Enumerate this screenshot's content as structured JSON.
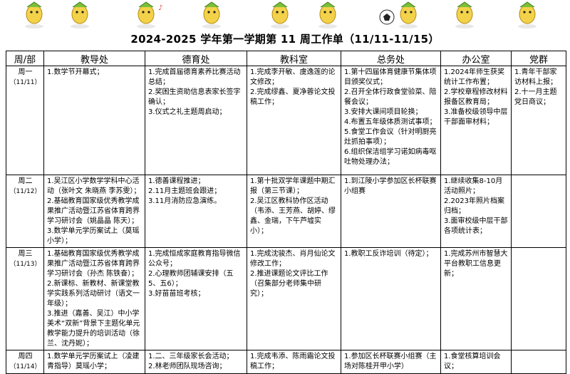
{
  "title": "2024-2025 学年第一学期第 11 周工作单（11/11-11/15）",
  "headers": [
    "周/部",
    "教导处",
    "德育处",
    "教科室",
    "总务处",
    "办公室",
    "党群"
  ],
  "rows": [
    {
      "day": "周一",
      "date": "（11/11）",
      "cells": [
        [
          "1.数学节开幕式；"
        ],
        [
          "1.完成首届德育素养比赛活动总结；",
          "2.奖困生资助信息表家长签字确认；",
          "3.仪式之礼主题周启动；"
        ],
        [
          "1.完成李开敏、虞逸莲的论文修改；",
          "2.完成缪鑫、夏净蓉论文投稿工作；"
        ],
        [
          "1.第十四届体育健康节集体项目颁奖仪式；",
          "2.召开全体行政食堂验菜、陪餐会议；",
          "3.安排大课间项目轮换；",
          "4.布置五年级体质测试事项；",
          "5.食堂工作会议（针对明厨亮灶抓拍事项）；",
          "6.组织保洁组学习诺如病毒呕吐物处理办法；"
        ],
        [
          "1.2024年师生获奖统计工作布置；",
          "2.学校章程修改材料报备区教育局；",
          "3.准备校级领导中层干部面审材料；"
        ],
        [
          "1.青年干部家访材料上报；",
          "2.十一月主题党日商议；"
        ]
      ]
    },
    {
      "day": "周二",
      "date": "（11/12）",
      "cells": [
        [
          "1.吴江区小学数学学科中心活动（张叶文 朱晓燕 李苏雯）；",
          "2.基础教育国家级优秀教学成果推广活动暨江苏省体育跨界学习研讨会（姚晶晶 陈天）；",
          "3.数学单元学历案试上（莫瑶小学）；"
        ],
        [
          "1.德善课程推进；",
          "2.11月主题班会跟进；",
          "3.11月消防应急演练。"
        ],
        [
          "1.第十批双学年课题中期汇报（第三节课）；",
          "2.吴江区教科协作区活动（韦添、王芳燕、胡婷、缪鑫、金瑞，下午芦墟实小）；"
        ],
        [
          "1.到江陵小学参加区长杯联赛小组赛"
        ],
        [
          "1.继续收集8-10月活动照片；",
          "2.2023年照片档案归档；",
          "3.面审校级中层干部各项统计表；"
        ],
        []
      ]
    },
    {
      "day": "周三",
      "date": "（11/13）",
      "cells": [
        [
          "1.基础教育国家级优秀教学成果推广活动暨江苏省体育跨界学习研讨会（孙杰 陈铁奋）；",
          "2.新课标、新教材、新课堂教学实践系列活动研讨（语文一年级）；",
          "3.推进（嘉善、吴江）中小学美术“双新”背景下主题化单元教学能力提升的培训活动（徐兰、沈丹妮）；"
        ],
        [
          "1.完成恒成家庭教育指导微信公众号；",
          "2.心理教师团辅课安排（五5、五6）；",
          "3.好苗苗班考核；"
        ],
        [
          "1.完成沈骏杰、肖月仙论文修改工作；",
          "2.推进课题论文评比工作（召集部分老师集中研究）；"
        ],
        [
          "1.教职工反诈培训（待定）；"
        ],
        [
          "1.完成苏州市智慧大平台教职工信息更新；"
        ],
        []
      ]
    },
    {
      "day": "周四",
      "date": "（11/14）",
      "cells": [
        [
          "1.数学单元学历案试上（凌建青指导）莫瑶小学；"
        ],
        [
          "1.二、三年级家长会活动；",
          "2.林老师团队现场咨询；"
        ],
        [
          "1.完成韦添、陈雨霜论文投稿工作；"
        ],
        [
          "1.参加区长杯联赛小组赛（主场对陈桂开甲小学）"
        ],
        [
          "1.食堂核算培训会议；"
        ],
        []
      ]
    }
  ]
}
